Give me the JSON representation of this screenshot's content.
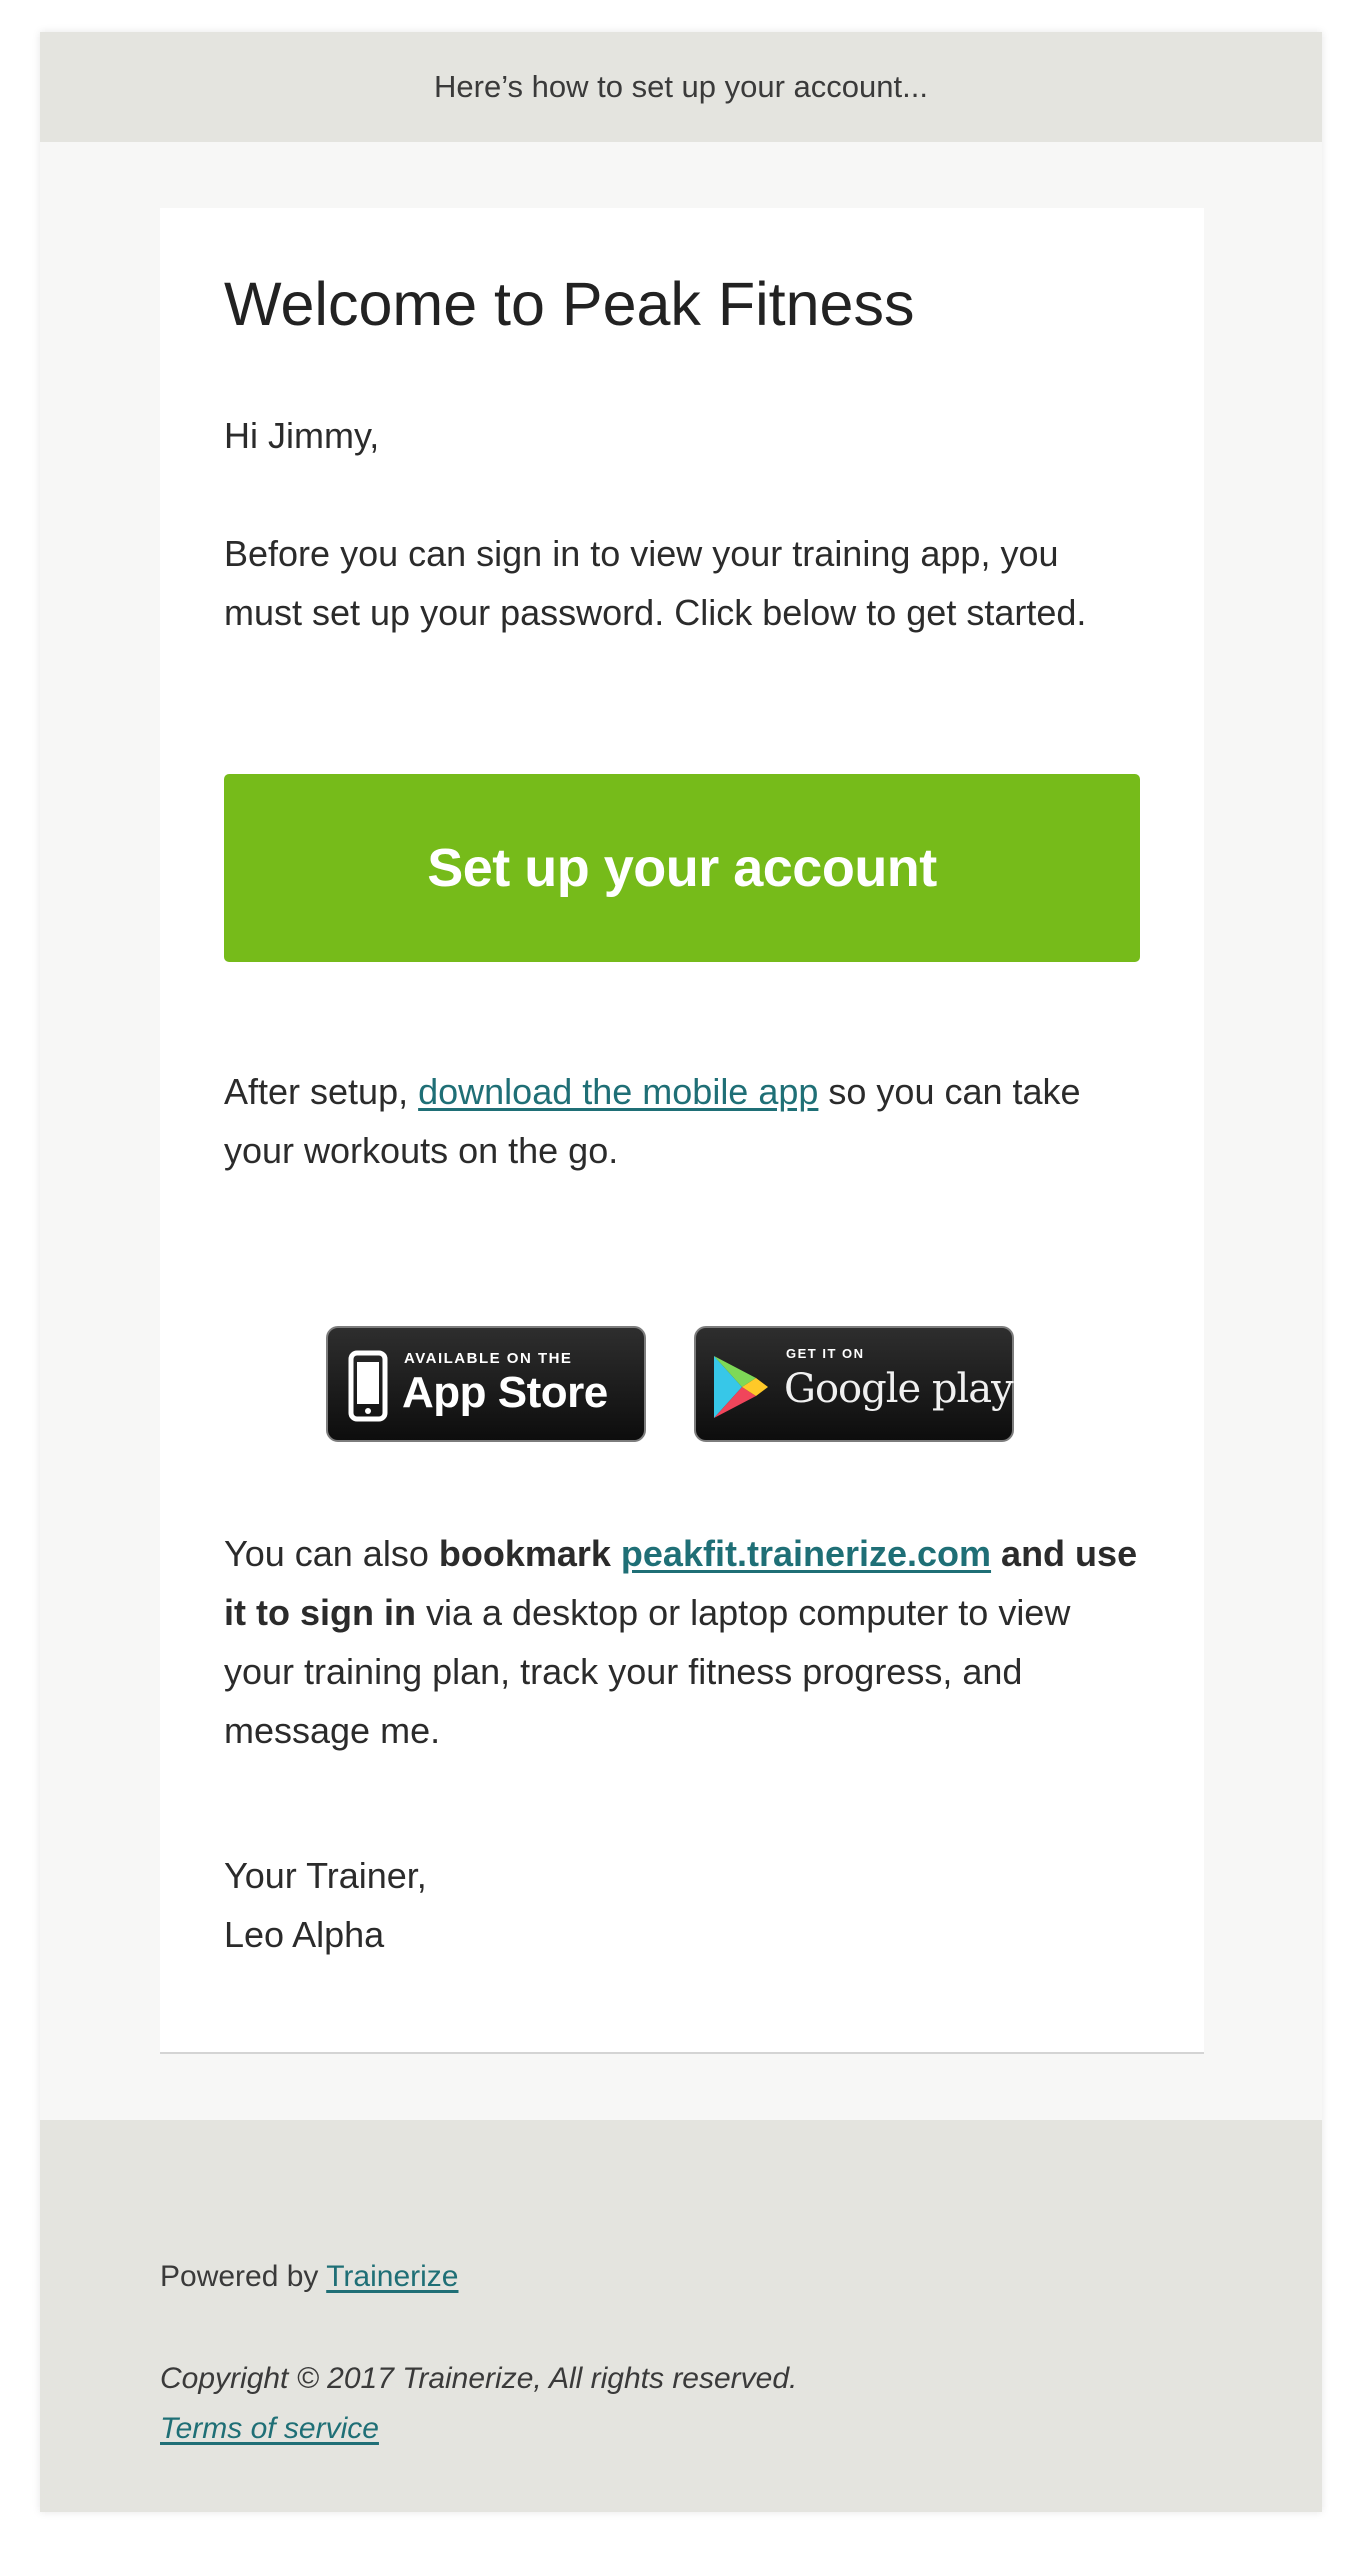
{
  "preheader": "Here’s how to set up your account...",
  "title": "Welcome to Peak Fitness",
  "greeting": "Hi Jimmy,",
  "intro": "Before you can sign in to view your training app, you must set up your password. Click below to get started.",
  "cta_label": "Set up your account",
  "after": {
    "before": "After setup, ",
    "link": "download the mobile app",
    "after": " so you can take your workouts on the go."
  },
  "badges": {
    "apple_small": "AVAILABLE ON THE",
    "apple_big": "App Store",
    "google_small": "GET IT ON",
    "google_big": "Google play"
  },
  "bookmark": {
    "t1": "You can also ",
    "b1": "bookmark",
    "space": " ",
    "link": "peakfit.trainerize.com",
    "b2": " and use it to sign in",
    "t2": " via a desktop or laptop computer to view your training plan, track your fitness progress, and message me."
  },
  "signoff": {
    "line1": "Your Trainer,",
    "line2": "Leo Alpha"
  },
  "footer": {
    "powered_prefix": "Powered by ",
    "powered_link": "Trainerize",
    "copyright": "Copyright © 2017 Trainerize, All rights reserved.",
    "terms": "Terms of service"
  },
  "colors": {
    "accent_green": "#76bb1a",
    "link_teal": "#1f6f76",
    "header_bg": "#e4e4df"
  },
  "icons": [
    "phone-icon",
    "play-triangle-icon"
  ]
}
